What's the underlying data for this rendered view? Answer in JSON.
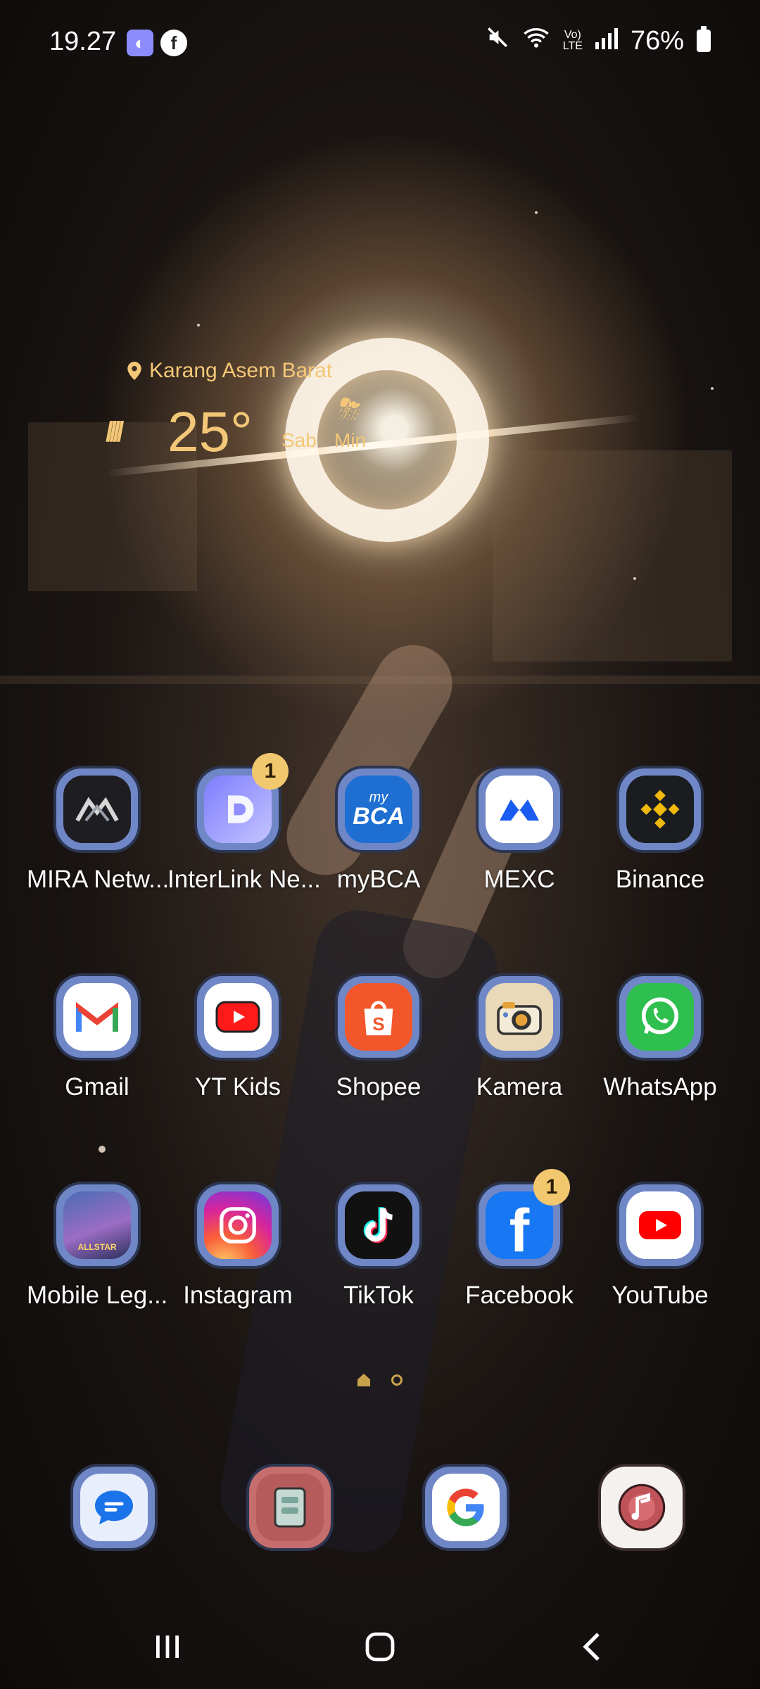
{
  "status_bar": {
    "time": "19.27",
    "battery": "76%",
    "network": "LTE"
  },
  "weather": {
    "location": "Karang Asem Barat",
    "temperature": "25°",
    "forecast": [
      {
        "day": "Sab",
        "icon": "thunder-rain-icon"
      },
      {
        "day": "Min",
        "icon": "cloud-icon"
      }
    ]
  },
  "apps": [
    {
      "label": "MIRA Netw...",
      "icon": "mira-icon"
    },
    {
      "label": "InterLink Ne...",
      "icon": "interlink-icon",
      "badge": "1"
    },
    {
      "label": "myBCA",
      "icon": "mybca-icon",
      "icon_text": "BCA",
      "icon_sub": "my"
    },
    {
      "label": "MEXC",
      "icon": "mexc-icon"
    },
    {
      "label": "Binance",
      "icon": "binance-icon"
    },
    {
      "label": "Gmail",
      "icon": "gmail-icon"
    },
    {
      "label": "YT Kids",
      "icon": "yt-kids-icon"
    },
    {
      "label": "Shopee",
      "icon": "shopee-icon"
    },
    {
      "label": "Kamera",
      "icon": "camera-icon"
    },
    {
      "label": "WhatsApp",
      "icon": "whatsapp-icon"
    },
    {
      "label": "Mobile Leg...",
      "icon": "mobile-legends-icon",
      "icon_text": "ALLSTAR"
    },
    {
      "label": "Instagram",
      "icon": "instagram-icon"
    },
    {
      "label": "TikTok",
      "icon": "tiktok-icon"
    },
    {
      "label": "Facebook",
      "icon": "facebook-icon",
      "badge": "1"
    },
    {
      "label": "YouTube",
      "icon": "youtube-icon"
    }
  ],
  "dock": [
    {
      "icon": "messages-icon"
    },
    {
      "icon": "notes-icon"
    },
    {
      "icon": "google-icon"
    },
    {
      "icon": "music-icon"
    }
  ],
  "colors": {
    "weather_text": "#f3c777",
    "badge": "#f2c86e",
    "icon_frame": "#6f87c6"
  }
}
